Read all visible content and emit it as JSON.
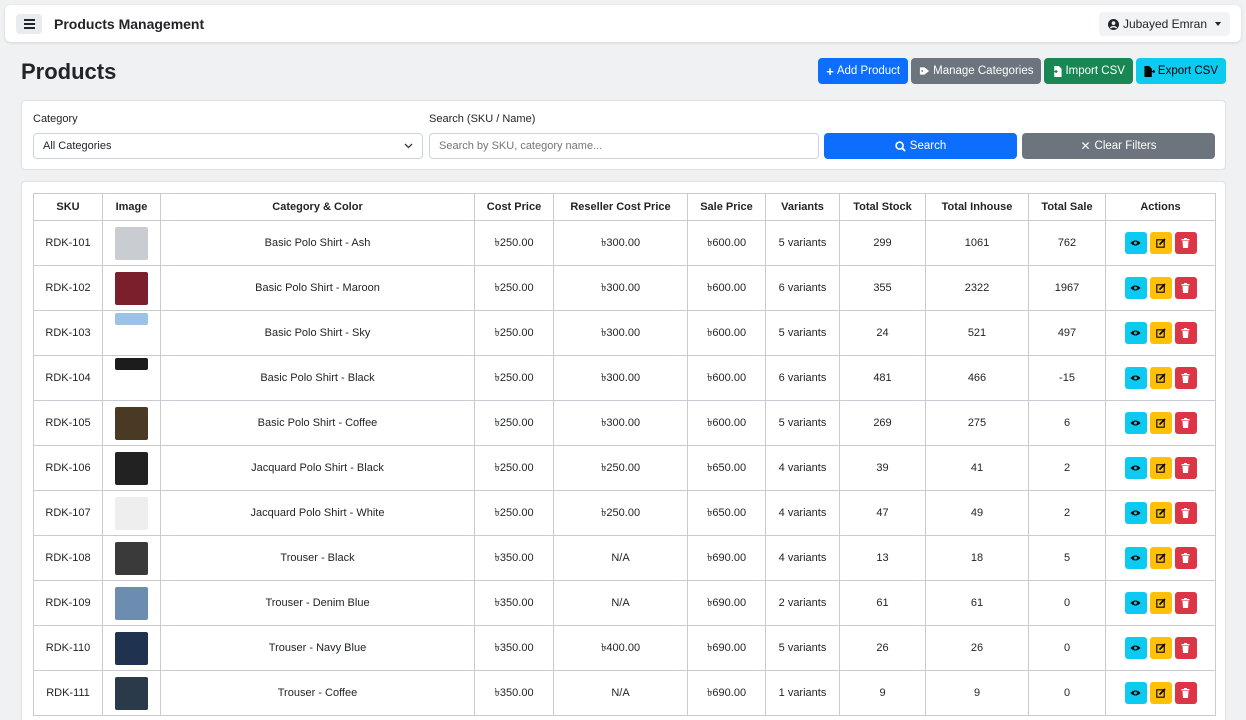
{
  "header": {
    "title": "Products Management",
    "user_name": "Jubayed Emran"
  },
  "page": {
    "title": "Products",
    "buttons": {
      "add_product": "Add Product",
      "manage_categories": "Manage Categories",
      "import_csv": "Import CSV",
      "export_csv": "Export CSV"
    }
  },
  "filters": {
    "category_label": "Category",
    "category_value": "All Categories",
    "search_label": "Search (SKU / Name)",
    "search_placeholder": "Search by SKU, category name...",
    "search_button": "Search",
    "clear_button": "Clear Filters"
  },
  "table": {
    "columns": [
      "SKU",
      "Image",
      "Category & Color",
      "Cost Price",
      "Reseller Cost Price",
      "Sale Price",
      "Variants",
      "Total Stock",
      "Total Inhouse",
      "Total Sale",
      "Actions"
    ],
    "rows": [
      {
        "sku": "RDK-101",
        "name": "Basic Polo Shirt - Ash",
        "cost": "৳250.00",
        "reseller": "৳300.00",
        "sale": "৳600.00",
        "variants": "5 variants",
        "stock": "299",
        "inhouse": "1061",
        "total_sale": "762",
        "thumb": "#c9cdd2"
      },
      {
        "sku": "RDK-102",
        "name": "Basic Polo Shirt - Maroon",
        "cost": "৳250.00",
        "reseller": "৳300.00",
        "sale": "৳600.00",
        "variants": "6 variants",
        "stock": "355",
        "inhouse": "2322",
        "total_sale": "1967",
        "thumb": "#7a1f2b"
      },
      {
        "sku": "RDK-103",
        "name": "Basic Polo Shirt - Sky",
        "cost": "৳250.00",
        "reseller": "৳300.00",
        "sale": "৳600.00",
        "variants": "5 variants",
        "stock": "24",
        "inhouse": "521",
        "total_sale": "497",
        "thumb": "#9cc3e6"
      },
      {
        "sku": "RDK-104",
        "name": "Basic Polo Shirt - Black",
        "cost": "৳250.00",
        "reseller": "৳300.00",
        "sale": "৳600.00",
        "variants": "6 variants",
        "stock": "481",
        "inhouse": "466",
        "total_sale": "-15",
        "thumb": "#1c1c1c"
      },
      {
        "sku": "RDK-105",
        "name": "Basic Polo Shirt - Coffee",
        "cost": "৳250.00",
        "reseller": "৳300.00",
        "sale": "৳600.00",
        "variants": "5 variants",
        "stock": "269",
        "inhouse": "275",
        "total_sale": "6",
        "thumb": "#4a3a24"
      },
      {
        "sku": "RDK-106",
        "name": "Jacquard Polo Shirt - Black",
        "cost": "৳250.00",
        "reseller": "৳250.00",
        "sale": "৳650.00",
        "variants": "4 variants",
        "stock": "39",
        "inhouse": "41",
        "total_sale": "2",
        "thumb": "#222222"
      },
      {
        "sku": "RDK-107",
        "name": "Jacquard Polo Shirt - White",
        "cost": "৳250.00",
        "reseller": "৳250.00",
        "sale": "৳650.00",
        "variants": "4 variants",
        "stock": "47",
        "inhouse": "49",
        "total_sale": "2",
        "thumb": "#eeeeee"
      },
      {
        "sku": "RDK-108",
        "name": "Trouser - Black",
        "cost": "৳350.00",
        "reseller": "N/A",
        "sale": "৳690.00",
        "variants": "4 variants",
        "stock": "13",
        "inhouse": "18",
        "total_sale": "5",
        "thumb": "#3a3a3a"
      },
      {
        "sku": "RDK-109",
        "name": "Trouser - Denim Blue",
        "cost": "৳350.00",
        "reseller": "N/A",
        "sale": "৳690.00",
        "variants": "2 variants",
        "stock": "61",
        "inhouse": "61",
        "total_sale": "0",
        "thumb": "#6d8db0"
      },
      {
        "sku": "RDK-110",
        "name": "Trouser - Navy Blue",
        "cost": "৳350.00",
        "reseller": "৳400.00",
        "sale": "৳690.00",
        "variants": "5 variants",
        "stock": "26",
        "inhouse": "26",
        "total_sale": "0",
        "thumb": "#1f3350"
      },
      {
        "sku": "RDK-111",
        "name": "Trouser - Coffee",
        "cost": "৳350.00",
        "reseller": "N/A",
        "sale": "৳690.00",
        "variants": "1 variants",
        "stock": "9",
        "inhouse": "9",
        "total_sale": "0",
        "thumb": "#2b3a4a"
      }
    ]
  },
  "icons": {
    "view": "eye-icon",
    "edit": "edit-icon",
    "delete": "trash-icon"
  },
  "colors": {
    "primary": "#0d6efd",
    "secondary": "#6c757d",
    "success": "#198754",
    "info": "#0dcaf0",
    "warning": "#ffc107",
    "danger": "#dc3545"
  }
}
